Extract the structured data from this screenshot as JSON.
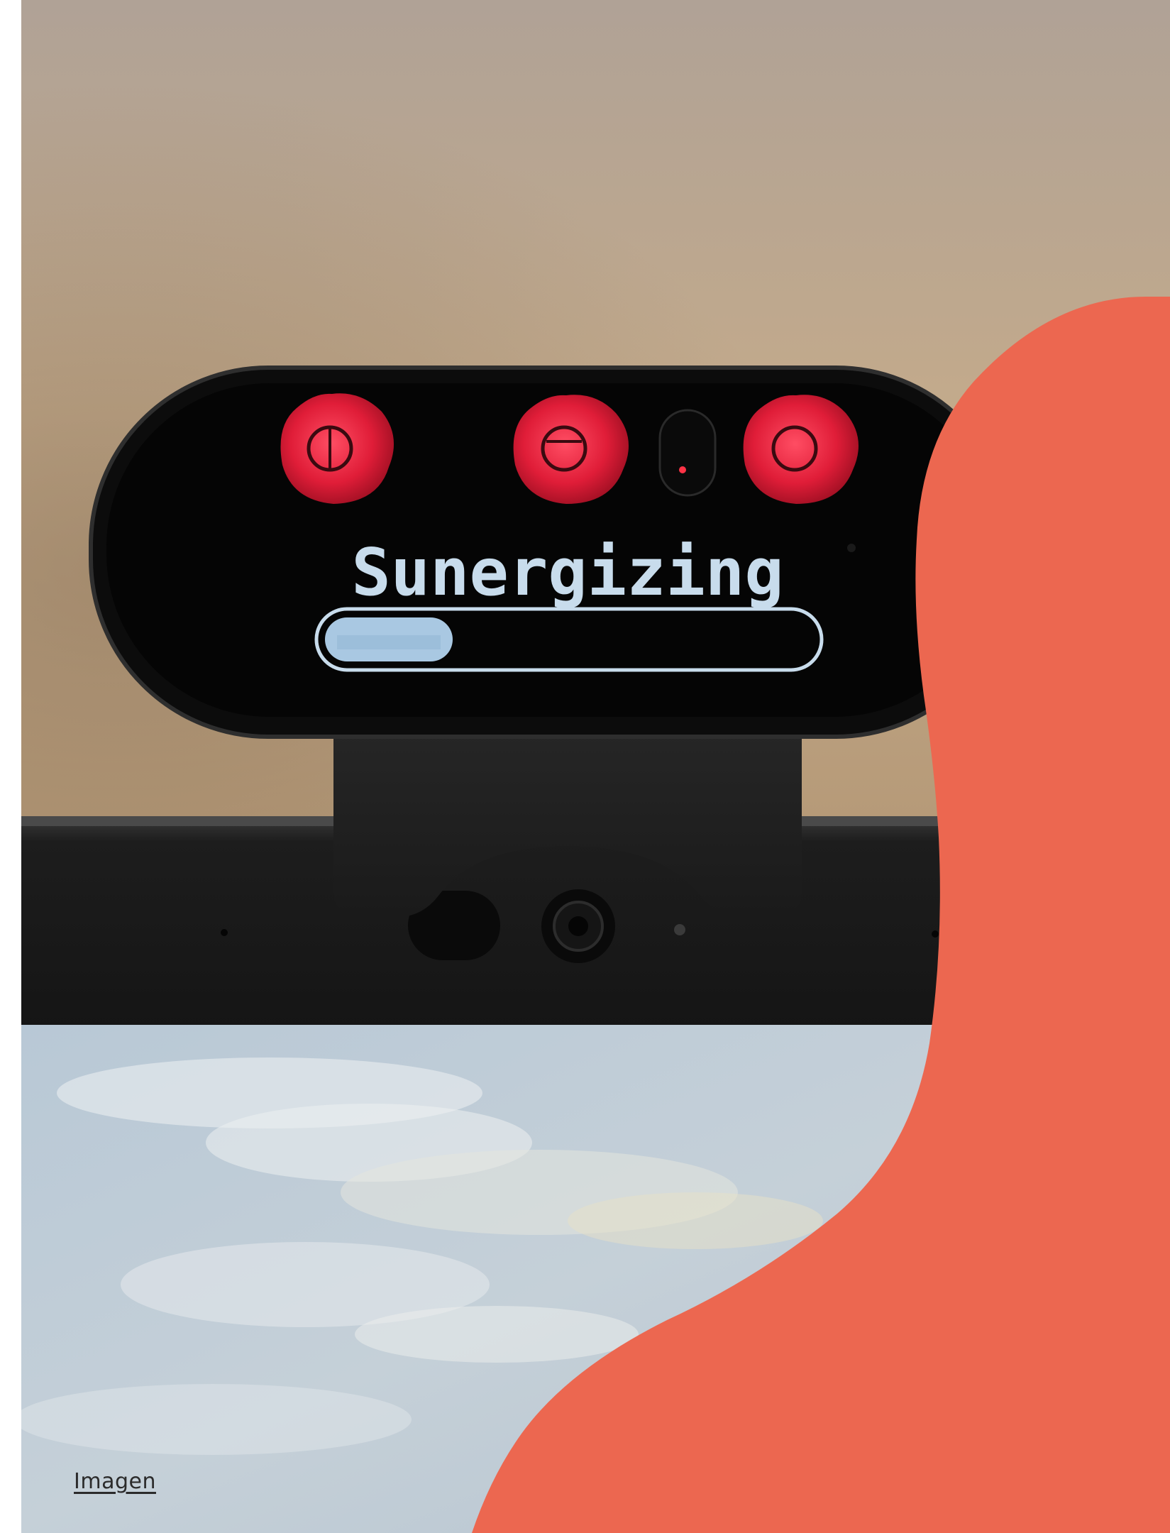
{
  "device_display": {
    "status_text": "Sunergizing",
    "progress_fraction": 0.23
  },
  "caption": {
    "link_text": "Imagen"
  },
  "colors": {
    "accent_blob": "#ec6750",
    "wall_top": "#b2a496",
    "wall_bottom": "#c6af8e",
    "screen_text": "#c8dcec",
    "progress_fill": "#a9c8e2",
    "red_led": "#e3203a",
    "device_body": "#0b0b0b"
  },
  "icons": [
    "tactile-button-icon",
    "camera-lens-icon",
    "tactile-button-icon",
    "tactile-button-icon"
  ]
}
